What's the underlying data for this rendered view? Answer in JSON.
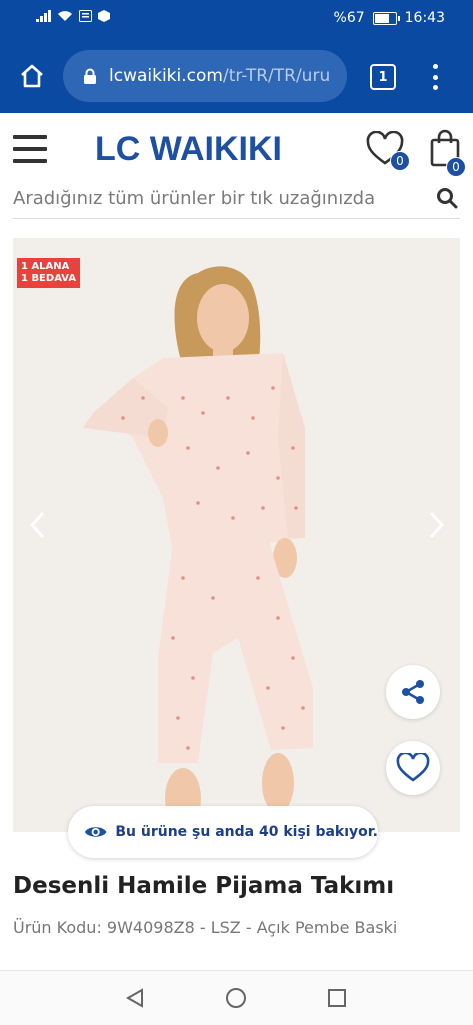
{
  "status_bar": {
    "battery": "%67",
    "time": "16:43"
  },
  "browser": {
    "url_domain": "lcwaikiki.com",
    "url_path": "/tr-TR/TR/uru",
    "tab_count": "1"
  },
  "header": {
    "logo": "LC WAIKIKI",
    "favorites_count": "0",
    "cart_count": "0"
  },
  "search": {
    "placeholder": "Aradığınız tüm ürünler bir tık uzağınızda"
  },
  "product": {
    "promo_line1": "1 ALANA",
    "promo_line2": "1 BEDAVA",
    "viewing_text": "Bu ürüne şu anda 40 kişi bakıyor.",
    "title": "Desenli Hamile Pijama Takımı",
    "code_line": "Ürün Kodu: 9W4098Z8 - LSZ - Açık Pembe Baski"
  },
  "colors": {
    "brand_blue": "#1d4fa3",
    "browser_blue": "#0b4aa2",
    "promo_red": "#e8423c"
  }
}
